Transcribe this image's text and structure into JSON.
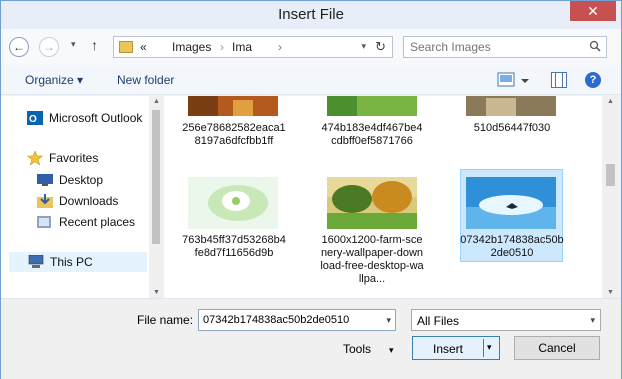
{
  "window": {
    "title": "Insert File",
    "close_glyph": "✕"
  },
  "nav": {
    "back_glyph": "←",
    "forward_glyph": "→",
    "recent_glyph": "▾",
    "up_glyph": "↑",
    "breadcrumbs": [
      "«",
      "Images",
      "Ima",
      "›"
    ],
    "refresh_glyph": "↻",
    "dropdown_glyph": "▾"
  },
  "search": {
    "placeholder": "Search Images"
  },
  "toolbar": {
    "organize": "Organize ▾",
    "new_folder": "New folder",
    "help": "?"
  },
  "sidebar": {
    "items": [
      {
        "label": "Microsoft Outlook",
        "icon": "outlook-icon"
      },
      {
        "label": "Favorites",
        "icon": "star-icon"
      },
      {
        "label": "Desktop",
        "icon": "desktop-icon"
      },
      {
        "label": "Downloads",
        "icon": "downloads-icon"
      },
      {
        "label": "Recent places",
        "icon": "recent-places-icon"
      },
      {
        "label": "This PC",
        "icon": "computer-icon"
      }
    ]
  },
  "files": [
    {
      "name": "256e78682582eaca18197a6dfcfbb1ff"
    },
    {
      "name": "474b183e4df467be4cdbff0ef5871766"
    },
    {
      "name": "510d56447f030"
    },
    {
      "name": "763b45ff37d53268b4fe8d7f11656d9b"
    },
    {
      "name": "1600x1200-farm-scenery-wallpaper-download-free-desktop-wallpa..."
    },
    {
      "name": "07342b174838ac50b2de0510",
      "selected": true
    }
  ],
  "bottom": {
    "file_name_label": "File name:",
    "file_name_value": "07342b174838ac50b2de0510",
    "filter_value": "All Files",
    "tools": "Tools",
    "insert": "Insert",
    "cancel": "Cancel",
    "dropdown_glyph": "▾"
  },
  "colors": {
    "accent": "#3c7fb1",
    "selection": "#cce8ff",
    "close": "#c75050"
  }
}
